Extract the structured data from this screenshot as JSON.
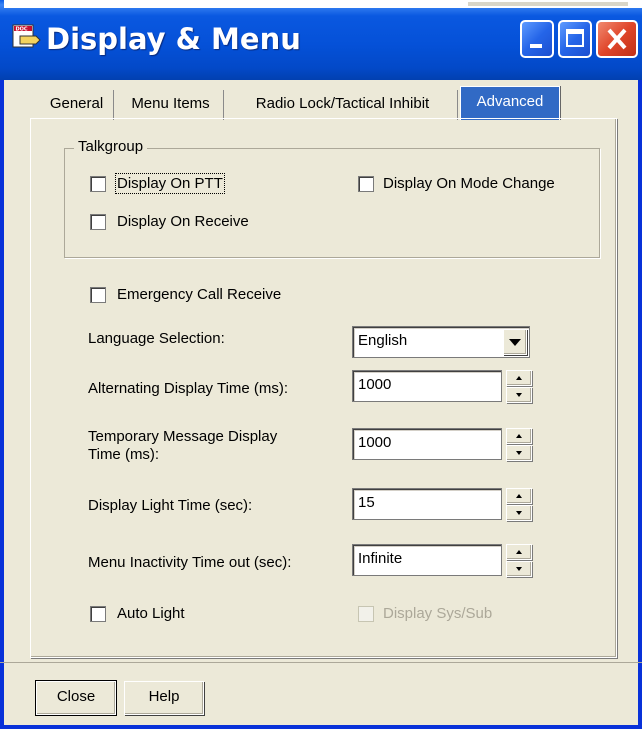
{
  "window": {
    "title": "Display & Menu",
    "icon_name": "doc-window-icon",
    "controls": [
      "minimize-icon",
      "maximize-icon",
      "close-icon"
    ],
    "accent_color": "#0a58e0"
  },
  "tabs": [
    {
      "label": "General",
      "active": false
    },
    {
      "label": "Menu Items",
      "active": false
    },
    {
      "label": "Radio Lock/Tactical Inhibit",
      "active": false
    },
    {
      "label": "Advanced",
      "active": true
    }
  ],
  "talkgroup": {
    "legend": "Talkgroup",
    "display_on_ptt": {
      "label": "Display On PTT",
      "checked": false
    },
    "display_on_mode_change": {
      "label": "Display On Mode Change",
      "checked": false
    },
    "display_on_receive": {
      "label": "Display On Receive",
      "checked": false
    }
  },
  "emergency_call_receive": {
    "label": "Emergency Call Receive",
    "checked": false
  },
  "language_selection": {
    "label": "Language Selection:",
    "value": "English"
  },
  "alternating_display_time": {
    "label": "Alternating Display Time (ms):",
    "value": "1000"
  },
  "temporary_message_display_time": {
    "label_line1": "Temporary Message Display",
    "label_line2": "Time (ms):",
    "value": "1000"
  },
  "display_light_time": {
    "label": "Display Light Time (sec):",
    "value": "15"
  },
  "menu_inactivity_timeout": {
    "label": "Menu Inactivity Time out (sec):",
    "value": "Infinite"
  },
  "auto_light": {
    "label": "Auto Light",
    "checked": false
  },
  "display_sys_sub": {
    "label": "Display Sys/Sub",
    "checked": false,
    "disabled": true
  },
  "buttons": {
    "close": "Close",
    "help": "Help"
  }
}
